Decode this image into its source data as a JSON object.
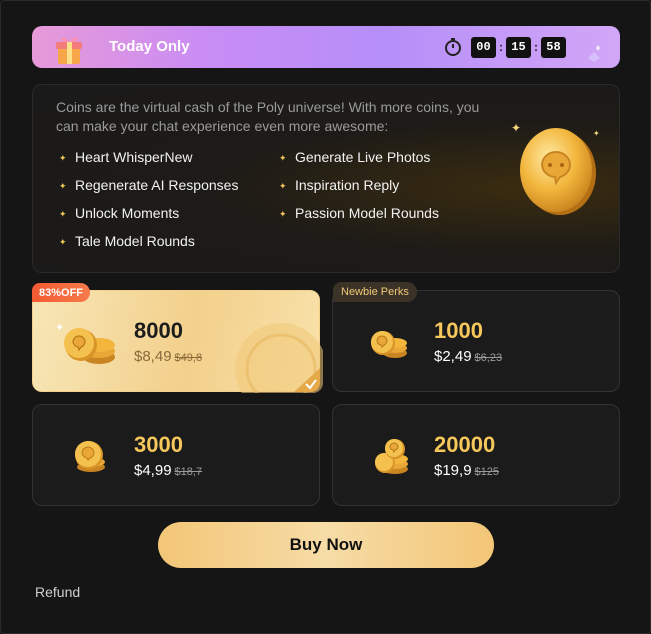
{
  "banner": {
    "title": "Today Only",
    "timer": {
      "hours": "00",
      "minutes": "15",
      "seconds": "58",
      "separator": ":"
    }
  },
  "info": {
    "intro": "Coins are the virtual cash of the Poly universe! With more coins, you can make your chat experience even more awesome:",
    "features_left": [
      "Heart WhisperNew",
      "Regenerate AI Responses",
      "Unlock Moments",
      "Tale Model Rounds"
    ],
    "features_right": [
      "Generate Live Photos",
      "Inspiration Reply",
      "Passion Model Rounds"
    ]
  },
  "packages": [
    {
      "amount": "8000",
      "price": "$8,49",
      "old_price": "$49,8",
      "badge": "83%OFF",
      "selected": true
    },
    {
      "amount": "1000",
      "price": "$2,49",
      "old_price": "$6,23",
      "badge": "Newbie Perks",
      "selected": false
    },
    {
      "amount": "3000",
      "price": "$4,99",
      "old_price": "$18,7",
      "badge": "",
      "selected": false
    },
    {
      "amount": "20000",
      "price": "$19,9",
      "old_price": "$125",
      "badge": "",
      "selected": false
    }
  ],
  "buy_label": "Buy Now",
  "refund_label": "Refund",
  "colors": {
    "accent_gold": "#f6c75a",
    "banner_gradient_start": "#e79ad8",
    "banner_gradient_end": "#b58ef8",
    "discount_badge": "#f35a32",
    "background": "#151515"
  },
  "icons": {
    "gift": "gift-icon",
    "clock": "stopwatch-icon",
    "coin": "coin-icon",
    "check": "check-icon",
    "star": "sparkle-icon"
  }
}
